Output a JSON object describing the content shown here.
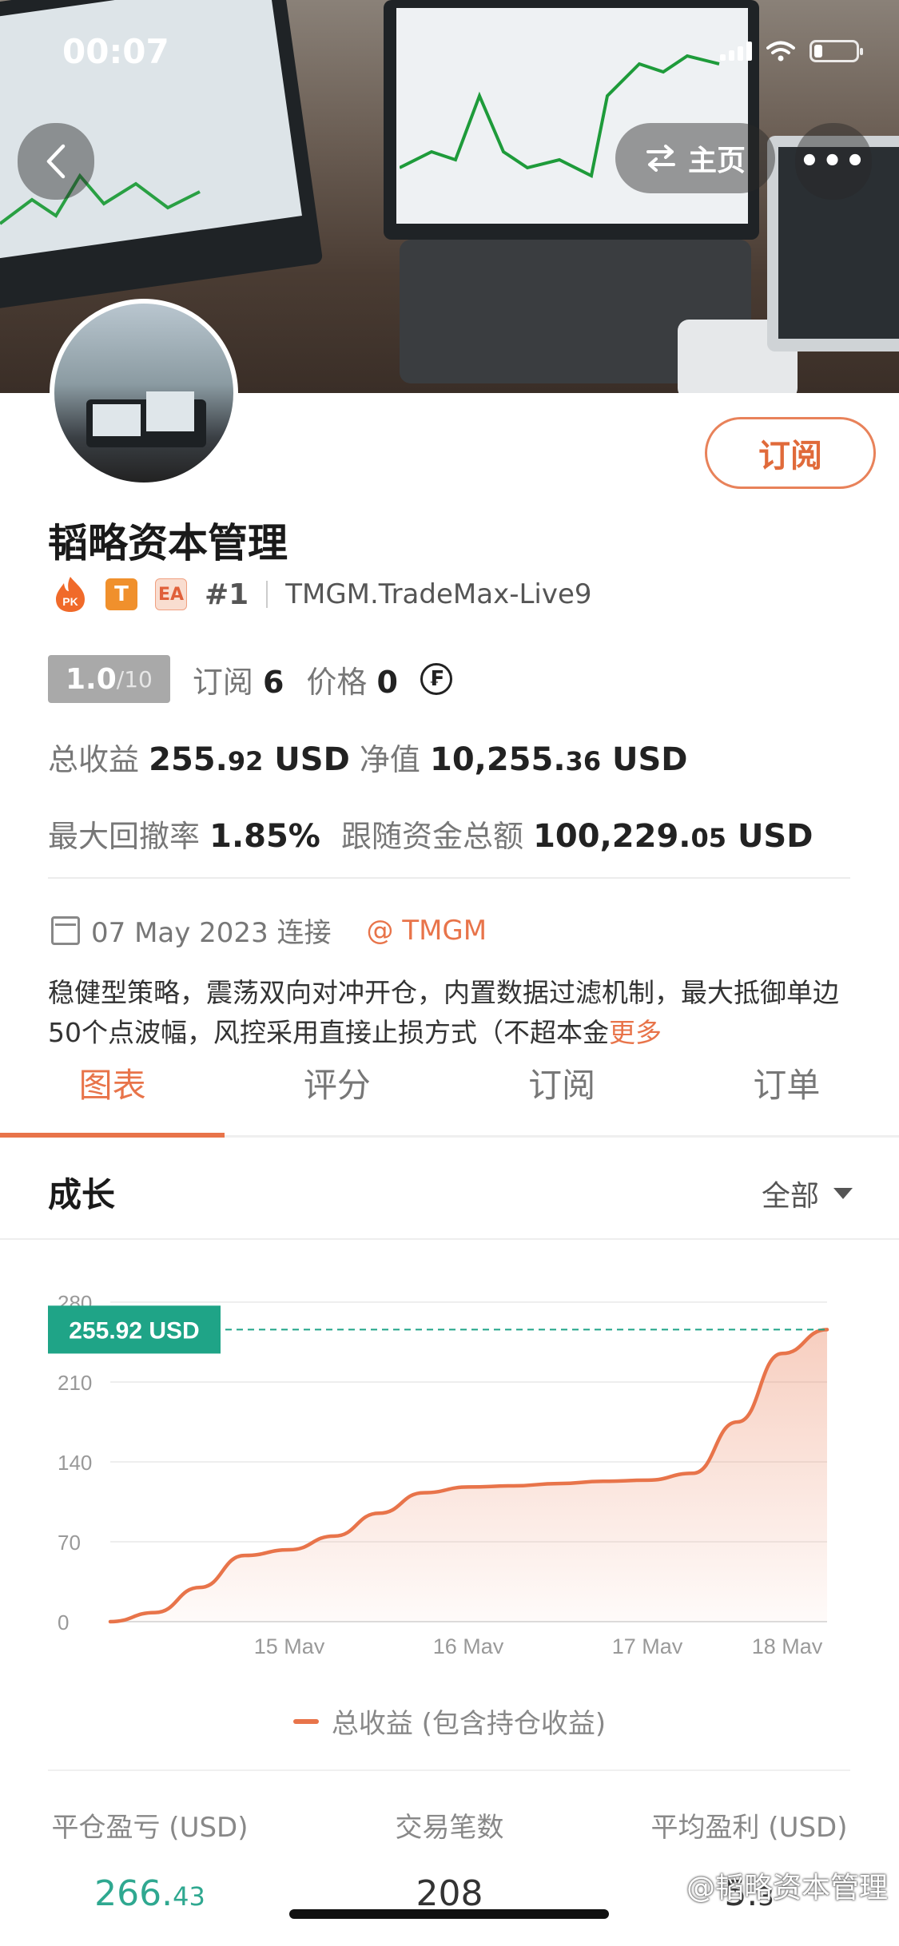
{
  "status_bar": {
    "time": "00:07"
  },
  "header": {
    "home_label": "主页",
    "more_label": "•••"
  },
  "profile": {
    "name": "韬略资本管理",
    "subscribe_label": "订阅",
    "badges": {
      "pk": "PK",
      "t": "T",
      "ea": "EA"
    },
    "rank": "#1",
    "server": "TMGM.TradeMax-Live9",
    "score": "1.0",
    "score_max": "/10",
    "subscribe_count_label": "订阅",
    "subscribe_count": "6",
    "price_label": "价格",
    "price": "0",
    "currency_icon": "₣"
  },
  "stats": {
    "total_profit_label": "总收益",
    "total_profit_int": "255.",
    "total_profit_dec": "92",
    "total_profit_unit": "USD",
    "equity_label": "净值",
    "equity_int": "10,255.",
    "equity_dec": "36",
    "equity_unit": "USD",
    "drawdown_label": "最大回撤率",
    "drawdown": "1.85%",
    "follow_label": "跟随资金总额",
    "follow_int": "100,229.",
    "follow_dec": "05",
    "follow_unit": "USD"
  },
  "connection": {
    "date_text": "07 May 2023 连接",
    "broker": "@ TMGM"
  },
  "description": {
    "text": "稳健型策略，震荡双向对冲开仓，内置数据过滤机制，最大抵御单边50个点波幅，风控采用直接止损方式（不超本金",
    "more": "更多"
  },
  "tabs": [
    {
      "label": "图表",
      "active": true
    },
    {
      "label": "评分",
      "active": false
    },
    {
      "label": "订阅",
      "active": false
    },
    {
      "label": "订单",
      "active": false
    }
  ],
  "growth": {
    "title": "成长",
    "filter": "全部"
  },
  "chart_data": {
    "type": "area",
    "series": [
      {
        "name": "总收益 (包含持仓收益)",
        "values": [
          0,
          8,
          30,
          58,
          63,
          75,
          95,
          113,
          118,
          119,
          121,
          123,
          124,
          130,
          175,
          235,
          255.92
        ]
      }
    ],
    "x": [
      "14 May",
      "14 May",
      "14 May",
      "15 May",
      "15 May",
      "15 May",
      "16 May",
      "16 May",
      "16 May",
      "16 May",
      "17 May",
      "17 May",
      "17 May",
      "17 May",
      "18 May",
      "18 May",
      "18 May"
    ],
    "x_ticks": [
      "15 May",
      "16 May",
      "17 May",
      "18 May"
    ],
    "y_ticks": [
      "0",
      "70",
      "140",
      "210",
      "280"
    ],
    "ylim": [
      0,
      280
    ],
    "current_label": "255.92 USD",
    "line_color": "#e8744a",
    "label_color": "#1fa487"
  },
  "legend": {
    "label": "总收益 (包含持仓收益)"
  },
  "summary": [
    {
      "label": "平仓盈亏 (USD)",
      "value_int": "266.",
      "value_dec": "43",
      "color": "green"
    },
    {
      "label": "交易笔数",
      "value_int": "208",
      "value_dec": "",
      "color": "default"
    },
    {
      "label": "平均盈利 (USD)",
      "value_int": "5.",
      "value_dec": "3",
      "color": "default"
    }
  ],
  "watermark": "@韬略资本管理"
}
